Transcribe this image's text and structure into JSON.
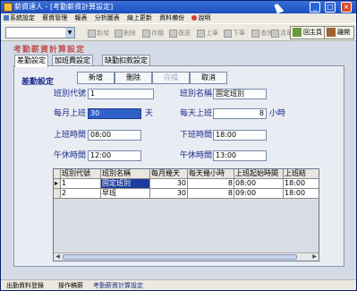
{
  "window": {
    "title": "薪資達人 - [考勤薪資計算設定]",
    "min": "_",
    "max": "□",
    "close": "×"
  },
  "menu": [
    "系統設定",
    "薪資管理",
    "報表",
    "分析圖表",
    "線上更新",
    "資料備份",
    "說明"
  ],
  "toolbar": {
    "combo_value": "",
    "buttons": [
      "新增",
      "刪除",
      "存檔",
      "復原",
      "上筆",
      "下筆",
      "查詢",
      "清單"
    ],
    "home": "回主頁",
    "exit": "離開"
  },
  "page": {
    "title": "考勤薪資計算設定"
  },
  "tabs": [
    "差勤設定",
    "加班費設定",
    "缺勤扣款設定"
  ],
  "section": {
    "title": "差勤設定"
  },
  "actions": {
    "add": "新增",
    "delete": "刪除",
    "save": "存檔",
    "cancel": "取消"
  },
  "form": {
    "shift_code": {
      "label": "班別代號",
      "value": "1"
    },
    "shift_name": {
      "label": "班別名稱",
      "value": "固定班別"
    },
    "monthly_days": {
      "label": "每月上班",
      "value": "30",
      "unit": "天"
    },
    "daily_hours": {
      "label": "每天上班",
      "value": "8",
      "unit": "小時"
    },
    "start_time": {
      "label": "上班時間",
      "value": "08:00"
    },
    "end_time": {
      "label": "下班時間",
      "value": "18:00"
    },
    "break_start": {
      "label": "午休時間",
      "value": "12:00"
    },
    "break_end": {
      "label": "午休時間",
      "value": "13:00"
    }
  },
  "grid": {
    "columns": [
      "班別代號",
      "班別名稱",
      "每月幾天",
      "每天幾小時",
      "上班起始時間",
      "上班結"
    ],
    "rows": [
      {
        "marker": "▸",
        "cells": [
          "1",
          "固定班別",
          "30",
          "8",
          "08:00",
          "18:00"
        ]
      },
      {
        "marker": "",
        "cells": [
          "2",
          "早班",
          "30",
          "8",
          "09:00",
          "18:00"
        ]
      }
    ]
  },
  "status": [
    "出勤資料登錄",
    "操作稿薪",
    "考勤薪資計算設定"
  ],
  "colors": {
    "accent_title": "#c0504d",
    "label": "#1a2a8a",
    "selected_row": "#1c3ca0"
  }
}
